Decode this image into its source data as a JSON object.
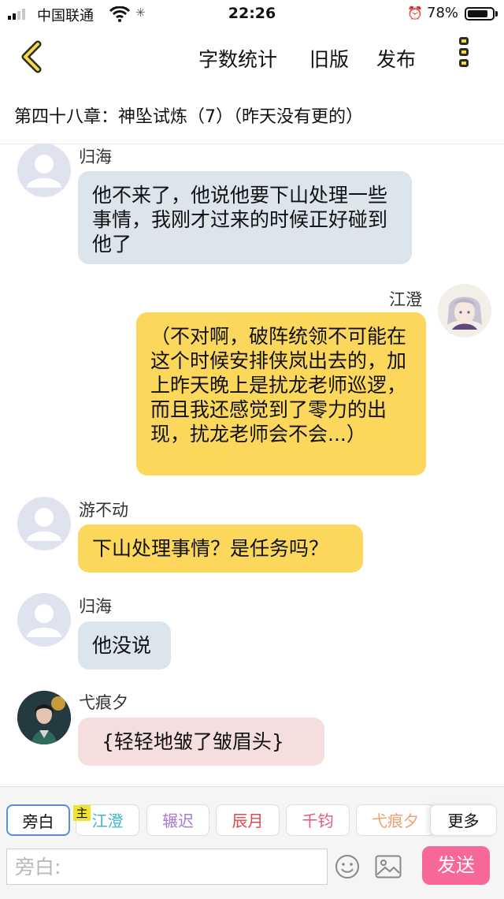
{
  "status": {
    "carrier": "中国联通",
    "time": "22:26",
    "battery": "78%"
  },
  "nav": {
    "word_count": "字数统计",
    "old_version": "旧版",
    "publish": "发布"
  },
  "chapter": {
    "title": "第四十八章：神坠试炼（7）（昨天没有更的）"
  },
  "messages": [
    {
      "name": "归海",
      "text": "他不来了，他说他要下山处理一些事情，我刚才过来的时候正好碰到他了"
    },
    {
      "name": "江澄",
      "text": "（不对啊，破阵统领不可能在这个时候安排侠岚出去的，加上昨天晚上是扰龙老师巡逻，而且我还感觉到了零力的出现，扰龙老师会不会...）"
    },
    {
      "name": "游不动",
      "text": "下山处理事情？是任务吗？"
    },
    {
      "name": "归海",
      "text": "他没说"
    },
    {
      "name": "弋痕夕",
      "text": "{轻轻地皱了皱眉头}"
    }
  ],
  "roles": [
    {
      "label": "旁白",
      "color": "#222222"
    },
    {
      "label": "江澄",
      "color": "#3fb6c8"
    },
    {
      "label": "辗迟",
      "color": "#a77cd6"
    },
    {
      "label": "辰月",
      "color": "#e0474c"
    },
    {
      "label": "千钧",
      "color": "#e05a7a"
    },
    {
      "label": "弋痕夕",
      "color": "#f0a070"
    }
  ],
  "main_tag": "主",
  "more_label": "更多",
  "input": {
    "placeholder": "旁白:"
  },
  "send_label": "发送"
}
